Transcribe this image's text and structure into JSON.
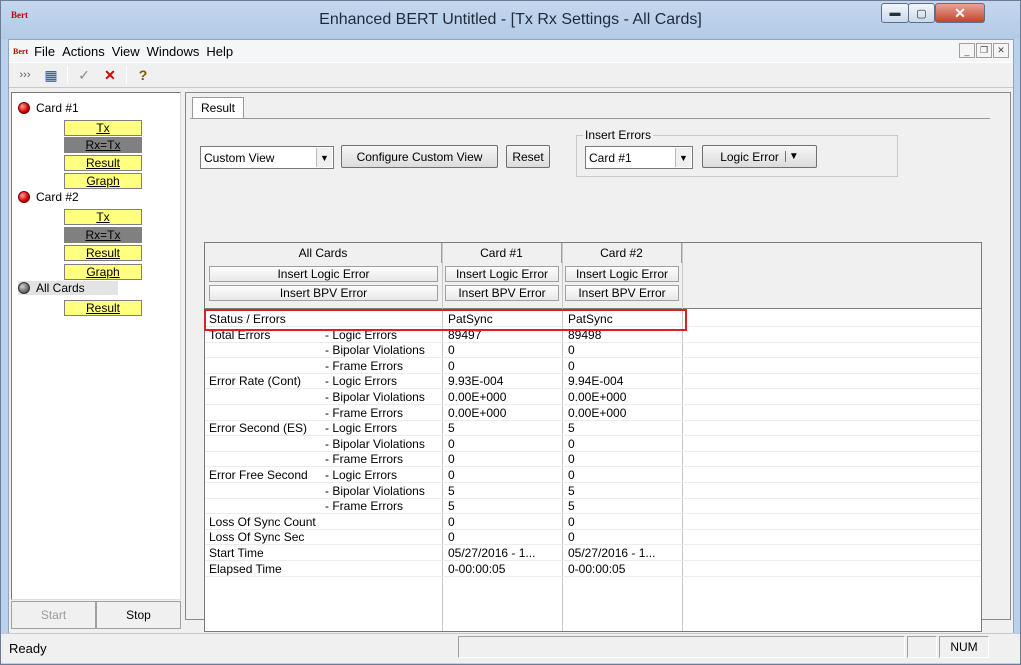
{
  "window": {
    "title": "Enhanced BERT Untitled - [Tx Rx Settings - All Cards]",
    "icon_text": "Bert"
  },
  "menu": {
    "logo": "Bert",
    "items": [
      "File",
      "Actions",
      "View",
      "Windows",
      "Help"
    ]
  },
  "toolbar": {
    "icons": [
      "chevrons-icon",
      "table-icon",
      "check-icon",
      "close-icon",
      "help-icon"
    ]
  },
  "sidebar": {
    "cards": [
      {
        "label": "Card #1",
        "led": "red",
        "buttons": [
          "Tx",
          "Rx=Tx",
          "Result",
          "Graph"
        ]
      },
      {
        "label": "Card #2",
        "led": "red",
        "buttons": [
          "Tx",
          "Rx=Tx",
          "Result",
          "Graph"
        ]
      },
      {
        "label": "All Cards",
        "led": "gray",
        "buttons": [
          "Result"
        ]
      }
    ],
    "start": "Start",
    "stop": "Stop"
  },
  "tab": {
    "label": "Result"
  },
  "controls": {
    "view_select": "Custom View",
    "configure_button": "Configure Custom View",
    "reset_button": "Reset",
    "insert_errors_title": "Insert Errors",
    "card_select": "Card #1",
    "logic_error_button": "Logic Error"
  },
  "grid": {
    "columns": [
      "All Cards",
      "Card #1",
      "Card #2"
    ],
    "insert_logic": "Insert Logic Error",
    "insert_bpv": "Insert BPV Error",
    "rows": [
      {
        "label": "Status / Errors",
        "sub": "",
        "v1": "PatSync",
        "v2": "PatSync"
      },
      {
        "label": "Total Errors",
        "sub": "- Logic Errors",
        "v1": "89497",
        "v2": "89498"
      },
      {
        "label": "",
        "sub": "- Bipolar Violations",
        "v1": "0",
        "v2": "0"
      },
      {
        "label": "",
        "sub": "- Frame Errors",
        "v1": "0",
        "v2": "0"
      },
      {
        "label": "Error Rate (Cont)",
        "sub": "- Logic Errors",
        "v1": "9.93E-004",
        "v2": "9.94E-004"
      },
      {
        "label": "",
        "sub": "- Bipolar Violations",
        "v1": "0.00E+000",
        "v2": "0.00E+000"
      },
      {
        "label": "",
        "sub": "- Frame Errors",
        "v1": "0.00E+000",
        "v2": "0.00E+000"
      },
      {
        "label": "Error Second (ES)",
        "sub": "- Logic Errors",
        "v1": "5",
        "v2": "5"
      },
      {
        "label": "",
        "sub": "- Bipolar Violations",
        "v1": "0",
        "v2": "0"
      },
      {
        "label": "",
        "sub": "- Frame Errors",
        "v1": "0",
        "v2": "0"
      },
      {
        "label": "Error Free Second",
        "sub": "- Logic Errors",
        "v1": "0",
        "v2": "0"
      },
      {
        "label": "",
        "sub": "- Bipolar Violations",
        "v1": "5",
        "v2": "5"
      },
      {
        "label": "",
        "sub": "- Frame Errors",
        "v1": "5",
        "v2": "5"
      },
      {
        "label": "Loss Of Sync Count",
        "sub": "",
        "v1": "0",
        "v2": "0"
      },
      {
        "label": "Loss Of Sync Sec",
        "sub": "",
        "v1": "0",
        "v2": "0"
      },
      {
        "label": "Start Time",
        "sub": "",
        "v1": "05/27/2016 - 1...",
        "v2": "05/27/2016 - 1..."
      },
      {
        "label": "Elapsed Time",
        "sub": "",
        "v1": "0-00:00:05",
        "v2": "0-00:00:05"
      }
    ]
  },
  "status": {
    "text": "Ready",
    "num": "NUM"
  }
}
